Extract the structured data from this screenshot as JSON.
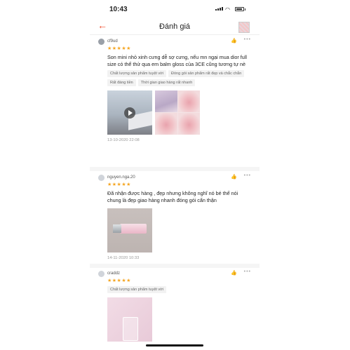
{
  "status": {
    "time": "10:43"
  },
  "header": {
    "title": "Đánh giá",
    "back_icon": "arrow-left-icon"
  },
  "reviews": [
    {
      "user": "cf9ud",
      "stars": "★★★★★",
      "text": "Son mini nhỏ xinh cưng dễ sợ cưng, nếu mn ngại mua dior full size có thể thử qua em balm gloss của 3CE cũng tương tự nè",
      "tags": [
        "Chất lượng sản phẩm tuyệt vời",
        "Đóng gói sản phẩm rất đẹp và chắc chắn",
        "Rất đáng tiền",
        "Thời gian giao hàng rất nhanh"
      ],
      "date": "13-10-2020 22:08"
    },
    {
      "user": "nguyen.nga.20",
      "stars": "★★★★★",
      "text": "Đã nhận được hàng , đẹp nhưng không nghĩ nó bé thế nói chung là đẹp giao hàng nhanh đóng gói cẩn thận",
      "tags": [],
      "date": "14-11-2020 10:33"
    },
    {
      "user": "craddz",
      "stars": "★★★★★",
      "text": "",
      "tags": [
        "Chất lượng sản phẩm tuyệt vời"
      ],
      "date": ""
    }
  ],
  "icons": {
    "like": "thumbs-up-icon",
    "more": "more-options-icon"
  },
  "colors": {
    "accent": "#ee4d2d",
    "star": "#f5a623"
  }
}
